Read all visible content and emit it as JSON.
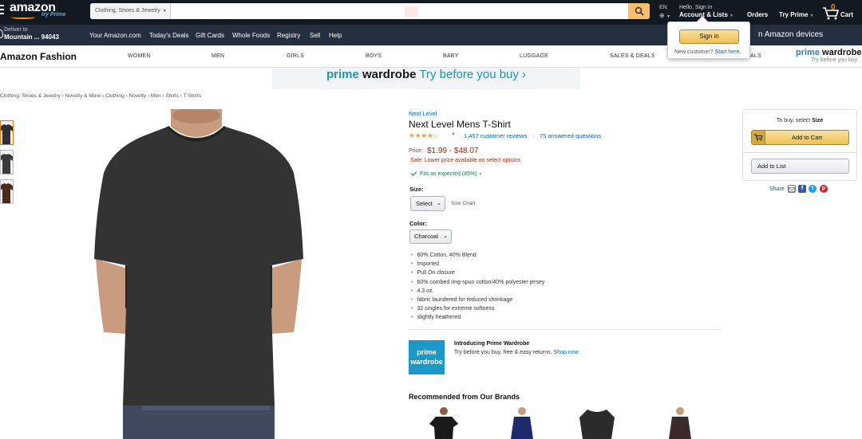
{
  "header": {
    "logo": "amazon",
    "logo_sub": "try Prime",
    "search_dept": "Clothing, Shoes & Jewelry",
    "search_value": "",
    "lang": "EN",
    "greeting": "Hello, Sign in",
    "account": "Account & Lists",
    "orders": "Orders",
    "try_prime": "Try Prime",
    "cart_count": "0",
    "cart_label": "Cart"
  },
  "subnav": {
    "deliver_line1": "Deliver to",
    "deliver_line2": "Mountain ... 94043",
    "links": [
      "Your Amazon.com",
      "Today's Deals",
      "Gift Cards",
      "Whole Foods",
      "Registry",
      "Sell",
      "Help"
    ],
    "promo": "n Amazon devices"
  },
  "fashion": {
    "title": "Amazon Fashion",
    "categories": [
      "WOMEN",
      "MEN",
      "GIRLS",
      "BOYS",
      "BABY",
      "LUGGAGE",
      "SALES & DEALS",
      "ALS"
    ],
    "logo_main_a": "prime",
    "logo_main_b": " wardrobe",
    "logo_sub": "Try before you buy"
  },
  "flyout": {
    "signin": "Sign in",
    "new_customer": "New customer?",
    "start_here": "Start here."
  },
  "banner": {
    "part1": "prime",
    "part2": " wardrobe",
    "part3": " Try before you buy ›"
  },
  "breadcrumb": "Clothing, Shoes & Jewelry › Novelty & More › Clothing › Novelty › Men › Shirts › T-Shirts",
  "product": {
    "brand": "Next Level",
    "title": "Next Level Mens T-Shirt",
    "stars": "★★★★☆",
    "rating": 4.5,
    "reviews": "1,457 customer reviews",
    "answered": "75 answered questions",
    "price_label": "Price:",
    "price": "$1.99 - $48.07",
    "sale": "Sale: Lower price available on select options",
    "fit": "Fits as expected (85%)",
    "size_label": "Size:",
    "size_select": "Select",
    "size_chart": "Size Chart",
    "color_label": "Color:",
    "color_select": "Charcoal",
    "bullets": [
      "60% Cotton, 40% Blend",
      "Imported",
      "Pull On closure",
      "60% combed ring-spun cotton/40% polyester jersey",
      "4.3 oz.",
      "fabric laundered for reduced shrinkage",
      "32 singles for extreme softness",
      "slightly heathered"
    ]
  },
  "prime_wardrobe": {
    "logo_l1": "prime",
    "logo_l2": "wardrobe",
    "intro": "Introducing Prime Wardrobe",
    "desc": "Try before you buy, free & easy returns.",
    "shop_now": "Shop now"
  },
  "recommended": {
    "title": "Recommended from Our Brands",
    "shirt_colors": [
      "#1a1a1a",
      "#1f2a6b",
      "#2b2b2b",
      "#3b2a2a"
    ]
  },
  "buybox": {
    "note": "To buy, select ",
    "note_bold": "Size",
    "add_to_cart": "Add to Cart",
    "add_to_list": "Add to List",
    "share": "Share"
  },
  "colors": {
    "nav_dark": "#131921",
    "nav_secondary": "#232f3e",
    "accent": "#febd69",
    "link": "#0066c0",
    "price": "#b12704",
    "prime_blue": "#1a98c8"
  }
}
